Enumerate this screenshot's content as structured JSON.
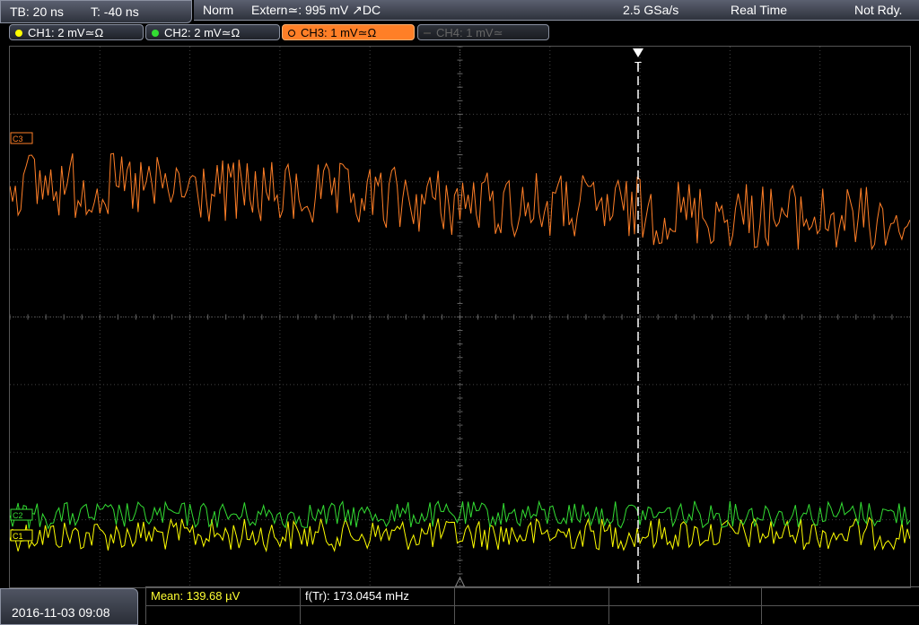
{
  "timebase": {
    "tb": "TB: 20 ns",
    "t": "T: -40 ns"
  },
  "status": {
    "mode": "Norm",
    "trigger": "Extern≃: 995 mV ↗DC",
    "sample_rate": "2.5 GSa/s",
    "acq": "Real Time",
    "state": "Not Rdy."
  },
  "channels": [
    {
      "label": "CH1: 2 mV≃Ω",
      "color": "#ffff00",
      "state": "on"
    },
    {
      "label": "CH2: 2 mV≃Ω",
      "color": "#33dd33",
      "state": "on"
    },
    {
      "label": "CH3: 1 mV≃Ω",
      "color": "#ff7f27",
      "state": "selected"
    },
    {
      "label": "CH4: 1 mV≃",
      "color": "#555555",
      "state": "off"
    }
  ],
  "markers": {
    "ch3": "C3",
    "ch1": "C1",
    "ch2": "C2",
    "trigger": "T"
  },
  "measurements": {
    "mean": "Mean: 139.68 µV",
    "freq": "f(Tr): 173.0454 mHz"
  },
  "datetime": "2016-11-03 09:08"
}
